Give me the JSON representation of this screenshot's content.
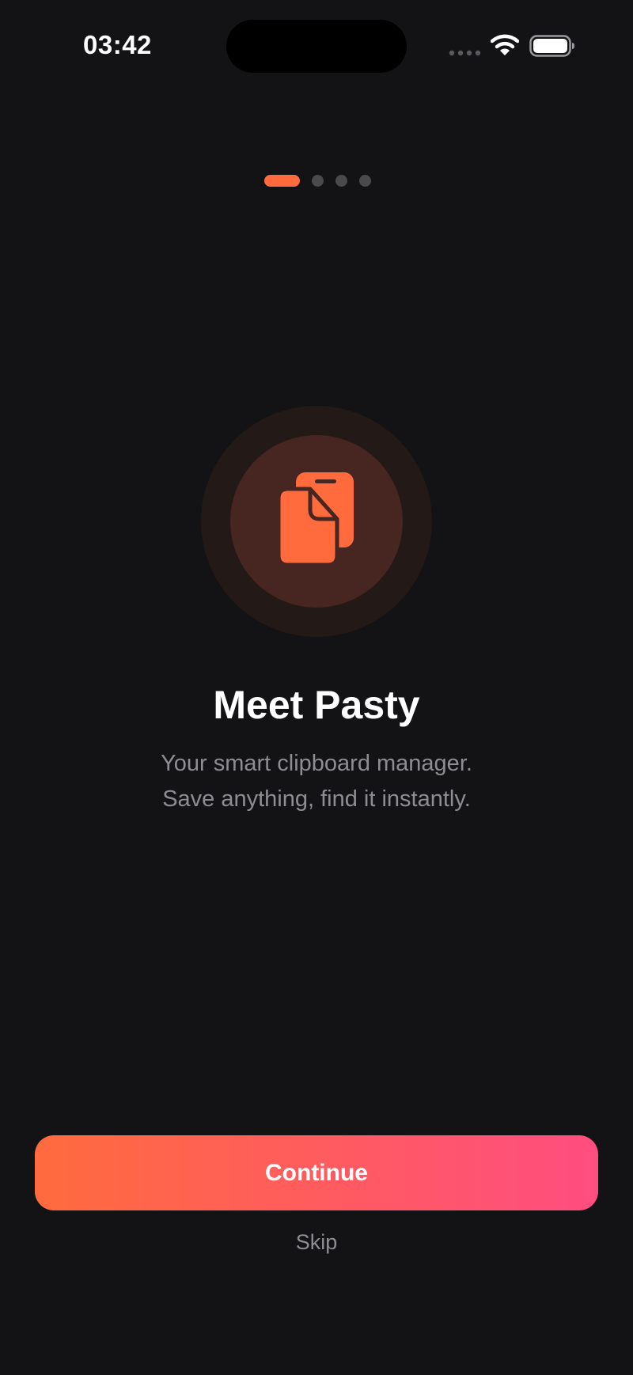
{
  "status_bar": {
    "time": "03:42",
    "icons": [
      "signal-icon",
      "wifi-icon",
      "battery-icon"
    ]
  },
  "pager": {
    "total_pages": 4,
    "current_page": 1
  },
  "hero": {
    "icon": "clipboard-icon",
    "title": "Meet Pasty",
    "subtitle_line1": "Your smart clipboard manager.",
    "subtitle_line2": "Save anything, find it instantly."
  },
  "actions": {
    "continue_label": "Continue",
    "skip_label": "Skip"
  },
  "colors": {
    "background": "#131315",
    "accent_start": "#ff6b3d",
    "accent_end": "#ff4d80",
    "secondary_text": "#8d8d92"
  }
}
